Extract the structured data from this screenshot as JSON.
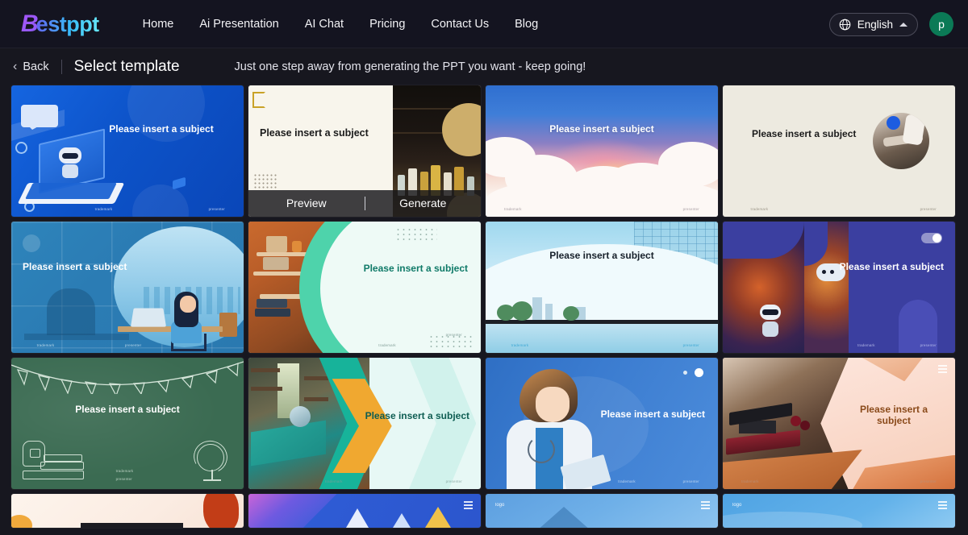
{
  "header": {
    "logo": {
      "first": "B",
      "rest": "estppt"
    },
    "nav": [
      {
        "label": "Home",
        "name": "nav-home"
      },
      {
        "label": "Ai Presentation",
        "name": "nav-ai-presentation"
      },
      {
        "label": "AI Chat",
        "name": "nav-ai-chat"
      },
      {
        "label": "Pricing",
        "name": "nav-pricing"
      },
      {
        "label": "Contact Us",
        "name": "nav-contact-us"
      },
      {
        "label": "Blog",
        "name": "nav-blog"
      }
    ],
    "language": {
      "label": "English",
      "icon": "globe-icon",
      "chevron": "chevron-up-icon"
    },
    "avatar": {
      "initial": "p",
      "color": "#0b7a56"
    }
  },
  "subheader": {
    "back_label": "Back",
    "back_icon": "chevron-left-icon",
    "title": "Select template",
    "tagline": "Just one step away from generating the PPT you want - keep going!"
  },
  "card_overlay": {
    "preview_label": "Preview",
    "generate_label": "Generate"
  },
  "slide_labels": {
    "subject": "Please insert a subject",
    "subject_wrapped": "Please insert a\nsubject",
    "trademark": "trademark",
    "presenter": "presenter",
    "logo": "logo"
  },
  "templates": [
    {
      "id": 1,
      "name": "template-blue-robot-laptop",
      "subject": "Please insert a subject",
      "hovered": false,
      "accent": "#0d53c9",
      "text_color": "#ffffff"
    },
    {
      "id": 2,
      "name": "template-bar-bottles",
      "subject": "Please insert a subject",
      "hovered": true,
      "accent": "#cdae6b",
      "text_color": "#1b1b1b"
    },
    {
      "id": 3,
      "name": "template-watercolor-sky",
      "subject": "Please insert a subject",
      "hovered": false,
      "accent": "#3f7ed8",
      "text_color": "#ffffff"
    },
    {
      "id": 4,
      "name": "template-beige-photo-circle",
      "subject": "Please insert a subject",
      "hovered": false,
      "accent": "#1d5ce0",
      "text_color": "#1b1b1b"
    },
    {
      "id": 5,
      "name": "template-blue-office-woman",
      "subject": "Please insert a subject",
      "hovered": false,
      "accent": "#2b7cb4",
      "text_color": "#ffffff"
    },
    {
      "id": 6,
      "name": "template-teal-bookshelf",
      "subject": "Please insert a subject",
      "hovered": false,
      "accent": "#4ed3ab",
      "text_color": "#0f7a68"
    },
    {
      "id": 7,
      "name": "template-cyan-city-glass",
      "subject": "Please insert a subject",
      "hovered": false,
      "accent": "#1ba3d4",
      "text_color": "#17202a"
    },
    {
      "id": 8,
      "name": "template-purple-robots",
      "subject": "Please insert a subject",
      "hovered": false,
      "accent": "#3b3fa0",
      "text_color": "#ffffff"
    },
    {
      "id": 9,
      "name": "template-green-chalkboard",
      "subject": "Please insert a subject",
      "hovered": false,
      "accent": "#3b6b52",
      "text_color": "#ffffff"
    },
    {
      "id": 10,
      "name": "template-library-chevrons",
      "subject": "Please insert a subject",
      "hovered": false,
      "accent": "#17b39a",
      "text_color": "#0e5d52"
    },
    {
      "id": 11,
      "name": "template-blue-doctor",
      "subject": "Please insert a subject",
      "hovered": false,
      "accent": "#3b7cd0",
      "text_color": "#ffffff"
    },
    {
      "id": 12,
      "name": "template-graduation-orange",
      "subject": "Please insert a\nsubject",
      "hovered": false,
      "accent": "#d4713c",
      "text_color": "#8a4a1a"
    }
  ],
  "templates_row4": [
    {
      "id": 13,
      "name": "template-cream-blob",
      "logo": ""
    },
    {
      "id": 14,
      "name": "template-blue-crystal",
      "logo": ""
    },
    {
      "id": 15,
      "name": "template-blue-mountain",
      "logo": "logo"
    },
    {
      "id": 16,
      "name": "template-blue-wave",
      "logo": "logo"
    }
  ]
}
